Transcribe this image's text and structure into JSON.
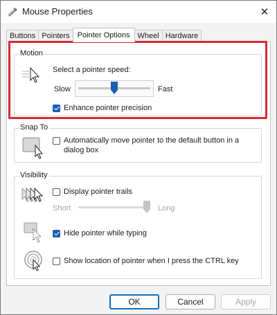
{
  "window": {
    "title": "Mouse Properties",
    "close_glyph": "✕",
    "accent_color": "#1a5fb4",
    "highlight_color": "#d42b35"
  },
  "tabs": [
    {
      "label": "Buttons",
      "active": false
    },
    {
      "label": "Pointers",
      "active": false
    },
    {
      "label": "Pointer Options",
      "active": true
    },
    {
      "label": "Wheel",
      "active": false
    },
    {
      "label": "Hardware",
      "active": false
    }
  ],
  "motion": {
    "group_label": "Motion",
    "icon": "pointer-speed-icon",
    "speed_label": "Select a pointer speed:",
    "slow_label": "Slow",
    "fast_label": "Fast",
    "speed_level_fraction": 0.5,
    "enhance_precision_label": "Enhance pointer precision",
    "enhance_precision_checked": true
  },
  "snap_to": {
    "group_label": "Snap To",
    "icon": "snap-to-icon",
    "auto_move_label_line1": "Automatically move pointer to the default button in a",
    "auto_move_label_line2": "dialog box",
    "auto_move_checked": false
  },
  "visibility": {
    "group_label": "Visibility",
    "trails_icon": "pointer-trails-icon",
    "trails_label": "Display pointer trails",
    "trails_checked": false,
    "short_label": "Short",
    "long_label": "Long",
    "trail_length_fraction": 1.0,
    "hide_icon": "hide-pointer-icon",
    "hide_label": "Hide pointer while typing",
    "hide_checked": true,
    "location_icon": "pointer-location-icon",
    "location_label": "Show location of pointer when I press the CTRL key",
    "location_checked": false
  },
  "buttons": {
    "ok": "OK",
    "cancel": "Cancel",
    "apply": "Apply"
  }
}
